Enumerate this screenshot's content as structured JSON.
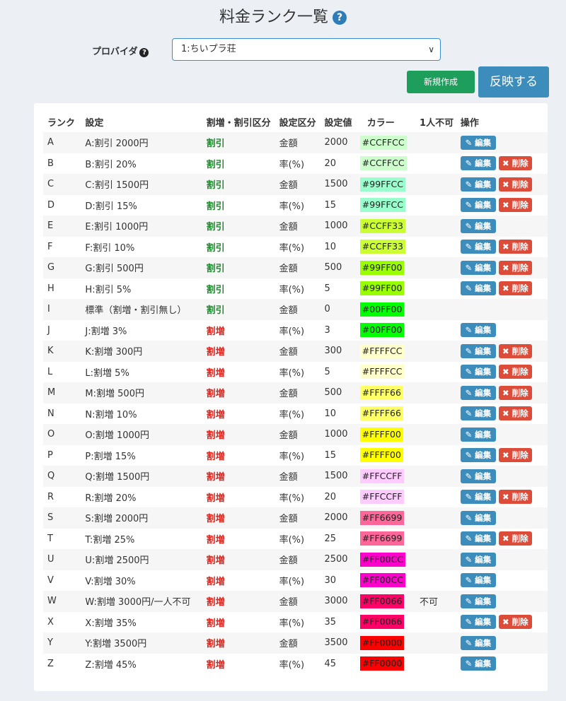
{
  "title": "料金ランク一覧",
  "help_icon": "?",
  "provider": {
    "label": "プロバイダ",
    "selected": "1:ちいプラ荘"
  },
  "buttons": {
    "new": "新規作成",
    "apply": "反映する"
  },
  "table": {
    "headers": [
      "ランク",
      "設定",
      "割増・割引区分",
      "設定区分",
      "設定値",
      "カラー",
      "1人不可",
      "操作"
    ],
    "edit_label": "編集",
    "delete_label": "削除",
    "rows": [
      {
        "rank": "A",
        "setting": "A:割引 2000円",
        "kind": "割引",
        "type": "金額",
        "value": "2000",
        "color": "#CCFFCC",
        "single": "",
        "del": false
      },
      {
        "rank": "B",
        "setting": "B:割引 20%",
        "kind": "割引",
        "type": "率(%)",
        "value": "20",
        "color": "#CCFFCC",
        "single": "",
        "del": true
      },
      {
        "rank": "C",
        "setting": "C:割引 1500円",
        "kind": "割引",
        "type": "金額",
        "value": "1500",
        "color": "#99FFCC",
        "single": "",
        "del": true
      },
      {
        "rank": "D",
        "setting": "D:割引 15%",
        "kind": "割引",
        "type": "率(%)",
        "value": "15",
        "color": "#99FFCC",
        "single": "",
        "del": true
      },
      {
        "rank": "E",
        "setting": "E:割引 1000円",
        "kind": "割引",
        "type": "金額",
        "value": "1000",
        "color": "#CCFF33",
        "single": "",
        "del": false
      },
      {
        "rank": "F",
        "setting": "F:割引 10%",
        "kind": "割引",
        "type": "率(%)",
        "value": "10",
        "color": "#CCFF33",
        "single": "",
        "del": true
      },
      {
        "rank": "G",
        "setting": "G:割引 500円",
        "kind": "割引",
        "type": "金額",
        "value": "500",
        "color": "#99FF00",
        "single": "",
        "del": true
      },
      {
        "rank": "H",
        "setting": "H:割引 5%",
        "kind": "割引",
        "type": "率(%)",
        "value": "5",
        "color": "#99FF00",
        "single": "",
        "del": true
      },
      {
        "rank": "I",
        "setting": "標準（割増・割引無し）",
        "kind": "割引",
        "type": "金額",
        "value": "0",
        "color": "#00FF00",
        "single": "",
        "del": false,
        "noedit": true
      },
      {
        "rank": "J",
        "setting": "J:割増 3%",
        "kind": "割増",
        "type": "率(%)",
        "value": "3",
        "color": "#00FF00",
        "single": "",
        "del": false
      },
      {
        "rank": "K",
        "setting": "K:割増 300円",
        "kind": "割増",
        "type": "金額",
        "value": "300",
        "color": "#FFFFCC",
        "single": "",
        "del": true
      },
      {
        "rank": "L",
        "setting": "L:割増 5%",
        "kind": "割増",
        "type": "率(%)",
        "value": "5",
        "color": "#FFFFCC",
        "single": "",
        "del": true
      },
      {
        "rank": "M",
        "setting": "M:割増 500円",
        "kind": "割増",
        "type": "金額",
        "value": "500",
        "color": "#FFFF66",
        "single": "",
        "del": true
      },
      {
        "rank": "N",
        "setting": "N:割増 10%",
        "kind": "割増",
        "type": "率(%)",
        "value": "10",
        "color": "#FFFF66",
        "single": "",
        "del": true
      },
      {
        "rank": "O",
        "setting": "O:割増 1000円",
        "kind": "割増",
        "type": "金額",
        "value": "1000",
        "color": "#FFFF00",
        "single": "",
        "del": false
      },
      {
        "rank": "P",
        "setting": "P:割増 15%",
        "kind": "割増",
        "type": "率(%)",
        "value": "15",
        "color": "#FFFF00",
        "single": "",
        "del": true
      },
      {
        "rank": "Q",
        "setting": "Q:割増 1500円",
        "kind": "割増",
        "type": "金額",
        "value": "1500",
        "color": "#FFCCFF",
        "single": "",
        "del": false
      },
      {
        "rank": "R",
        "setting": "R:割増 20%",
        "kind": "割増",
        "type": "率(%)",
        "value": "20",
        "color": "#FFCCFF",
        "single": "",
        "del": true
      },
      {
        "rank": "S",
        "setting": "S:割増 2000円",
        "kind": "割増",
        "type": "金額",
        "value": "2000",
        "color": "#FF6699",
        "single": "",
        "del": false
      },
      {
        "rank": "T",
        "setting": "T:割増 25%",
        "kind": "割増",
        "type": "率(%)",
        "value": "25",
        "color": "#FF6699",
        "single": "",
        "del": true
      },
      {
        "rank": "U",
        "setting": "U:割増 2500円",
        "kind": "割増",
        "type": "金額",
        "value": "2500",
        "color": "#FF00CC",
        "single": "",
        "del": false
      },
      {
        "rank": "V",
        "setting": "V:割増 30%",
        "kind": "割増",
        "type": "率(%)",
        "value": "30",
        "color": "#FF00CC",
        "single": "",
        "del": false
      },
      {
        "rank": "W",
        "setting": "W:割増 3000円/一人不可",
        "kind": "割増",
        "type": "金額",
        "value": "3000",
        "color": "#FF0066",
        "single": "不可",
        "del": false
      },
      {
        "rank": "X",
        "setting": "X:割増 35%",
        "kind": "割増",
        "type": "率(%)",
        "value": "35",
        "color": "#FF0066",
        "single": "",
        "del": true
      },
      {
        "rank": "Y",
        "setting": "Y:割増 3500円",
        "kind": "割増",
        "type": "金額",
        "value": "3500",
        "color": "#FF0000",
        "single": "",
        "del": false
      },
      {
        "rank": "Z",
        "setting": "Z:割増 45%",
        "kind": "割増",
        "type": "率(%)",
        "value": "45",
        "color": "#FF0000",
        "single": "",
        "del": false
      }
    ]
  }
}
